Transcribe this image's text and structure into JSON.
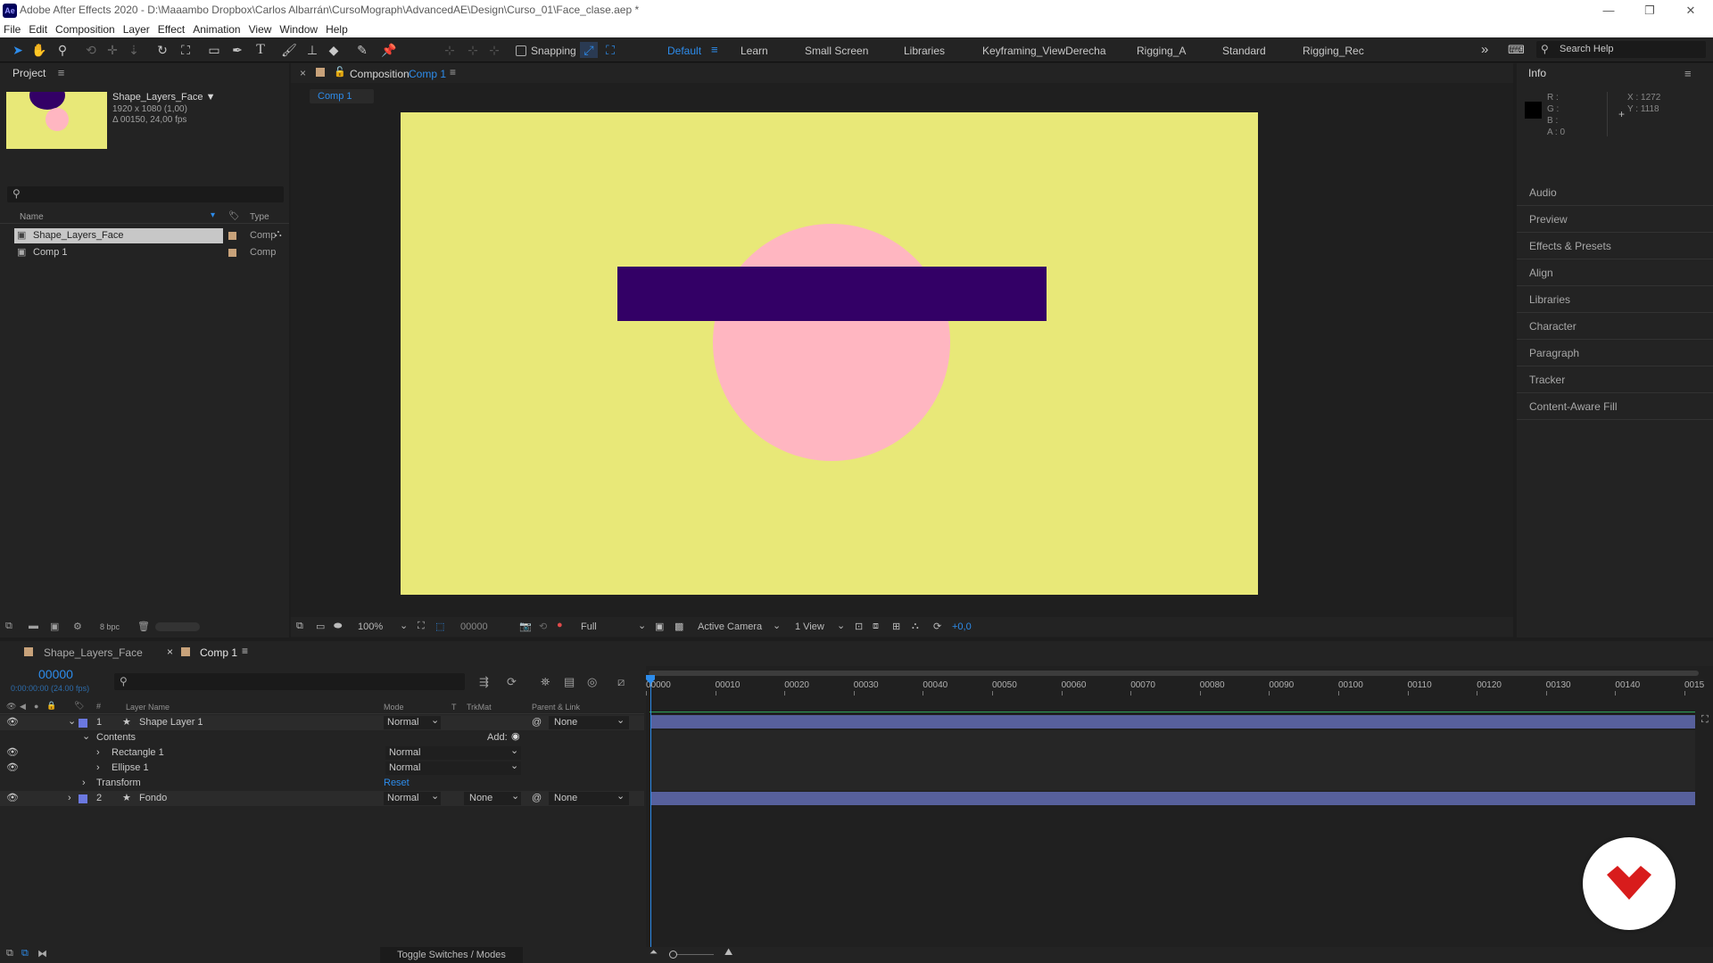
{
  "window": {
    "title": "Adobe After Effects 2020 - D:\\Maaambo Dropbox\\Carlos Albarrán\\CursoMograph\\AdvancedAE\\Design\\Curso_01\\Face_clase.aep *",
    "logo": "Ae",
    "controls": [
      "minimize-icon",
      "restore-icon",
      "close-icon"
    ]
  },
  "menu": [
    "File",
    "Edit",
    "Composition",
    "Layer",
    "Effect",
    "Animation",
    "View",
    "Window",
    "Help"
  ],
  "toolbar": {
    "tools": [
      "selection-tool-icon",
      "hand-tool-icon",
      "zoom-tool-icon",
      "orbit-camera-icon",
      "pan-camera-icon",
      "dolly-camera-icon",
      "rotation-tool-icon",
      "pan-behind-icon",
      "rectangle-tool-icon",
      "pen-tool-icon",
      "type-tool-icon",
      "brush-tool-icon",
      "clone-stamp-icon",
      "eraser-tool-icon",
      "roto-brush-icon",
      "puppet-pin-icon"
    ],
    "snapping_label": "Snapping",
    "workspaces": [
      "Default",
      "Learn",
      "Small Screen",
      "Libraries",
      "Keyframing_ViewDerecha",
      "Rigging_A",
      "Standard",
      "Rigging_Rec"
    ],
    "active_workspace": "Default",
    "search_help": "Search Help"
  },
  "project": {
    "title": "Project",
    "item_name": "Shape_Layers_Face ▼",
    "item_res": "1920 x 1080 (1,00)",
    "item_dur": "Δ 00150, 24,00 fps",
    "search_placeholder": "",
    "col_name": "Name",
    "col_type": "Type",
    "items": [
      {
        "name": "Shape_Layers_Face",
        "type": "Comp",
        "selected": true
      },
      {
        "name": "Comp 1",
        "type": "Comp",
        "selected": false
      }
    ],
    "bpc": "8 bpc"
  },
  "composition": {
    "panel_label": "Composition",
    "comp_name": "Comp 1",
    "tab": "Comp 1",
    "zoom": "100%",
    "timecode": "00000",
    "resolution": "Full",
    "camera": "Active Camera",
    "views": "1 View",
    "exposure": "+0,0",
    "colors": {
      "background": "#e8e878",
      "circle": "#ffb6c1",
      "rect": "#330066"
    }
  },
  "info": {
    "title": "Info",
    "r": "R :",
    "g": "G :",
    "b": "B :",
    "a": "A :  0",
    "x": "X : 1272",
    "y": "Y : 1118"
  },
  "right_panels": [
    "Audio",
    "Preview",
    "Effects & Presets",
    "Align",
    "Libraries",
    "Character",
    "Paragraph",
    "Tracker",
    "Content-Aware Fill"
  ],
  "timeline": {
    "tabs": [
      {
        "label": "Shape_Layers_Face",
        "active": false
      },
      {
        "label": "Comp 1",
        "active": true
      }
    ],
    "timecode": "00000",
    "timecode_sub": "0:00:00:00 (24.00 fps)",
    "col_layer_name": "Layer Name",
    "col_mode": "Mode",
    "col_t": "T",
    "col_trkmat": "TrkMat",
    "col_parent": "Parent & Link",
    "ruler": [
      "00000",
      "00010",
      "00020",
      "00030",
      "00040",
      "00050",
      "00060",
      "00070",
      "00080",
      "00090",
      "00100",
      "00110",
      "00120",
      "00130",
      "00140",
      "0015"
    ],
    "layer1": {
      "num": "1",
      "name": "Shape Layer 1",
      "mode": "Normal",
      "parent": "None"
    },
    "contents_label": "Contents",
    "add_label": "Add:",
    "rect": {
      "name": "Rectangle 1",
      "mode": "Normal"
    },
    "ellipse": {
      "name": "Ellipse 1",
      "mode": "Normal"
    },
    "transform": {
      "name": "Transform",
      "reset": "Reset"
    },
    "layer2": {
      "num": "2",
      "name": "Fondo",
      "mode": "Normal",
      "trkmat": "None",
      "parent": "None"
    },
    "toggle_label": "Toggle Switches / Modes",
    "layer_color": "#6b78e0"
  }
}
